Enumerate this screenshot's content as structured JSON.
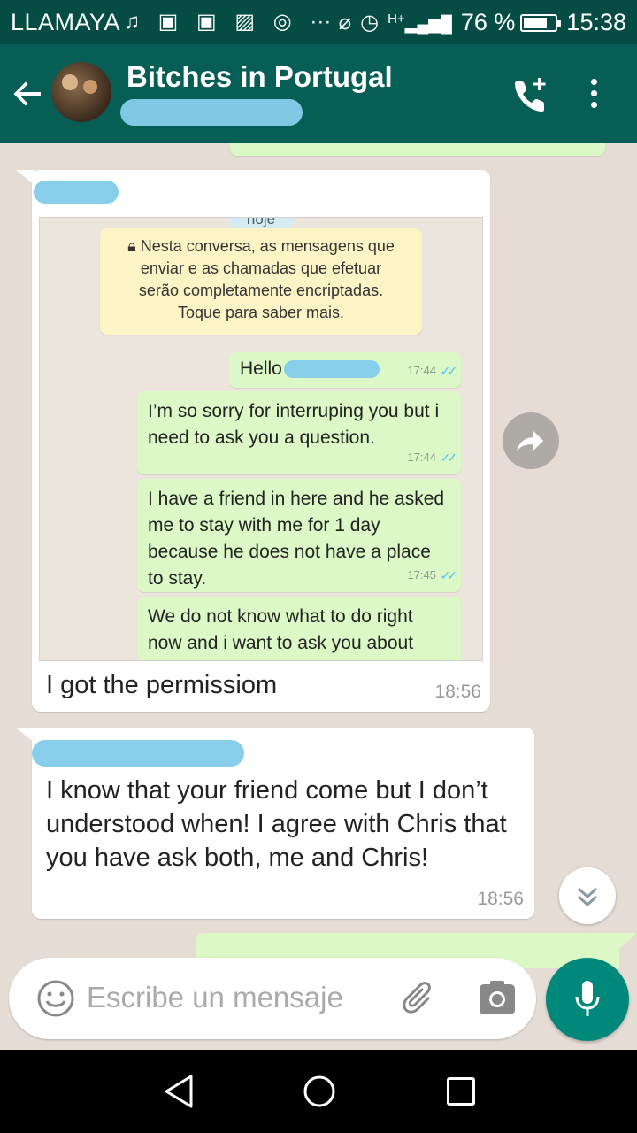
{
  "status_bar": {
    "carrier": "LLAMAYA",
    "network": "H+",
    "battery_percent": "76 %",
    "battery_level": 0.76,
    "time": "15:38"
  },
  "header": {
    "title": "Bitches in Portugal"
  },
  "messages": [
    {
      "type": "image",
      "direction": "incoming",
      "screenshot": {
        "date_chip": "hoje",
        "encryption_notice": [
          "Nesta conversa, as mensagens que",
          "enviar e as chamadas que efetuar",
          "serão completamente encriptadas.",
          "Toque para saber mais."
        ],
        "messages": [
          {
            "text": "Hello",
            "time": "17:44"
          },
          {
            "text": "I’m so sorry for interruping you but i need to ask you a question.",
            "time": "17:44"
          },
          {
            "text": "I have a friend in here and he asked me to stay with me for 1 day because he does not have a place to stay.",
            "time": "17:45"
          },
          {
            "text": "We do not know what to do right now and i want to ask you about",
            "time": ""
          }
        ]
      },
      "caption": "I got the permissiom",
      "time": "18:56"
    },
    {
      "type": "text",
      "direction": "incoming",
      "text": "I know that your friend come but I don’t understood when! I agree with Chris that you have ask both, me and Chris!",
      "time": "18:56"
    }
  ],
  "composer": {
    "placeholder": "Escribe un mensaje"
  },
  "icons": {
    "back": "arrow-left-icon",
    "add_call": "phone-plus-icon",
    "menu": "more-vert-icon",
    "forward": "forward-icon",
    "scroll": "chevron-down-icon",
    "emoji": "smiley-icon",
    "attach": "paperclip-icon",
    "camera": "camera-icon",
    "mic": "mic-icon"
  },
  "colors": {
    "toolbar": "#075e54",
    "status_bar": "#054d44",
    "outgoing_bubble": "#dcf8c6",
    "incoming_bubble": "#ffffff",
    "accent": "#00897b",
    "read_ticks": "#4fc3f7"
  }
}
